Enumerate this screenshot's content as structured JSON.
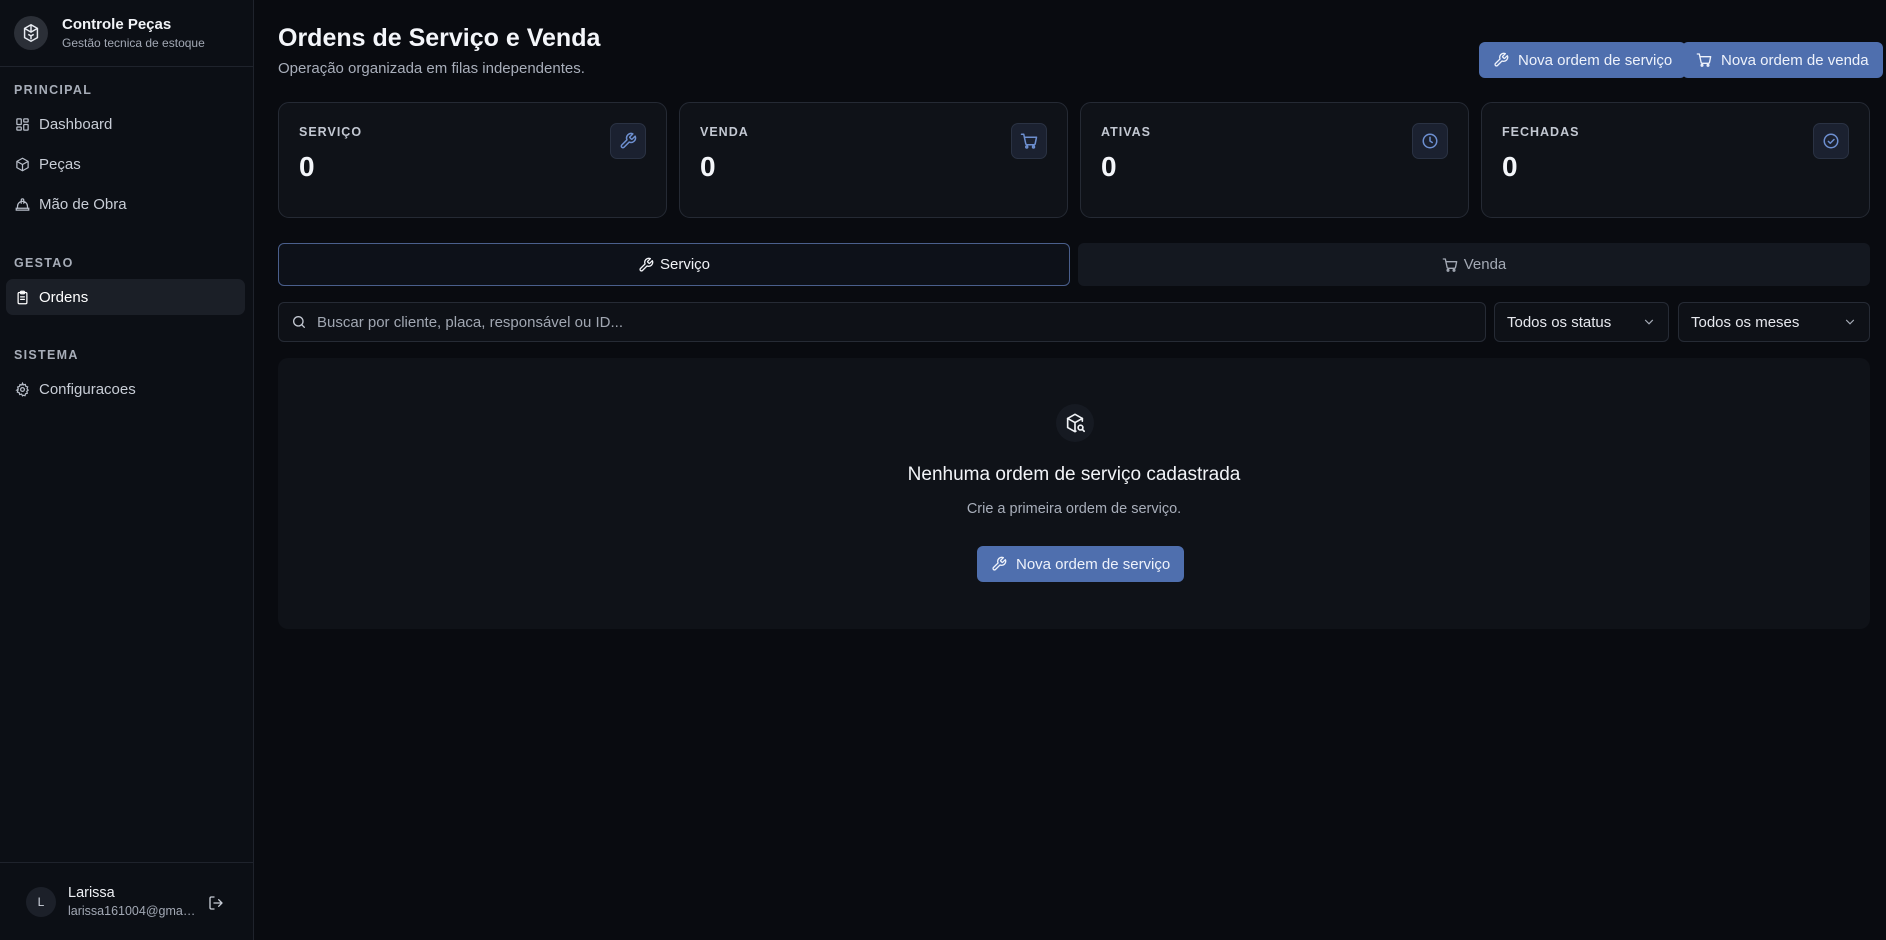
{
  "brand": {
    "title": "Controle Peças",
    "subtitle": "Gestão tecnica de estoque"
  },
  "sidebar": {
    "sections": [
      {
        "label": "PRINCIPAL",
        "items": [
          {
            "label": "Dashboard",
            "icon": "dashboard-icon"
          },
          {
            "label": "Peças",
            "icon": "package-icon"
          },
          {
            "label": "Mão de Obra",
            "icon": "labor-icon"
          }
        ]
      },
      {
        "label": "GESTAO",
        "items": [
          {
            "label": "Ordens",
            "icon": "clipboard-icon",
            "active": true
          }
        ]
      },
      {
        "label": "SISTEMA",
        "items": [
          {
            "label": "Configuracoes",
            "icon": "gear-icon"
          }
        ]
      }
    ]
  },
  "user": {
    "initial": "L",
    "name": "Larissa",
    "email": "larissa161004@gmail.com"
  },
  "header": {
    "title": "Ordens de Serviço e Venda",
    "subtitle": "Operação organizada em filas independentes.",
    "new_service_label": "Nova ordem de serviço",
    "new_sale_label": "Nova ordem de venda"
  },
  "stats": [
    {
      "label": "SERVIÇO",
      "value": "0",
      "icon": "wrench-icon"
    },
    {
      "label": "VENDA",
      "value": "0",
      "icon": "cart-icon"
    },
    {
      "label": "ATIVAS",
      "value": "0",
      "icon": "clock-icon"
    },
    {
      "label": "FECHADAS",
      "value": "0",
      "icon": "check-circle-icon"
    }
  ],
  "tabs": [
    {
      "label": "Serviço",
      "icon": "wrench-icon",
      "active": true
    },
    {
      "label": "Venda",
      "icon": "cart-icon",
      "active": false
    }
  ],
  "search": {
    "placeholder": "Buscar por cliente, placa, responsável ou ID..."
  },
  "filters": {
    "status": "Todos os status",
    "month": "Todos os meses"
  },
  "empty": {
    "title": "Nenhuma ordem de serviço cadastrada",
    "subtitle": "Crie a primeira ordem de serviço.",
    "button_label": "Nova ordem de serviço"
  },
  "colors": {
    "accent": "#4f6fae",
    "icon_accent": "#6d8fd0",
    "background": "#090b10"
  }
}
